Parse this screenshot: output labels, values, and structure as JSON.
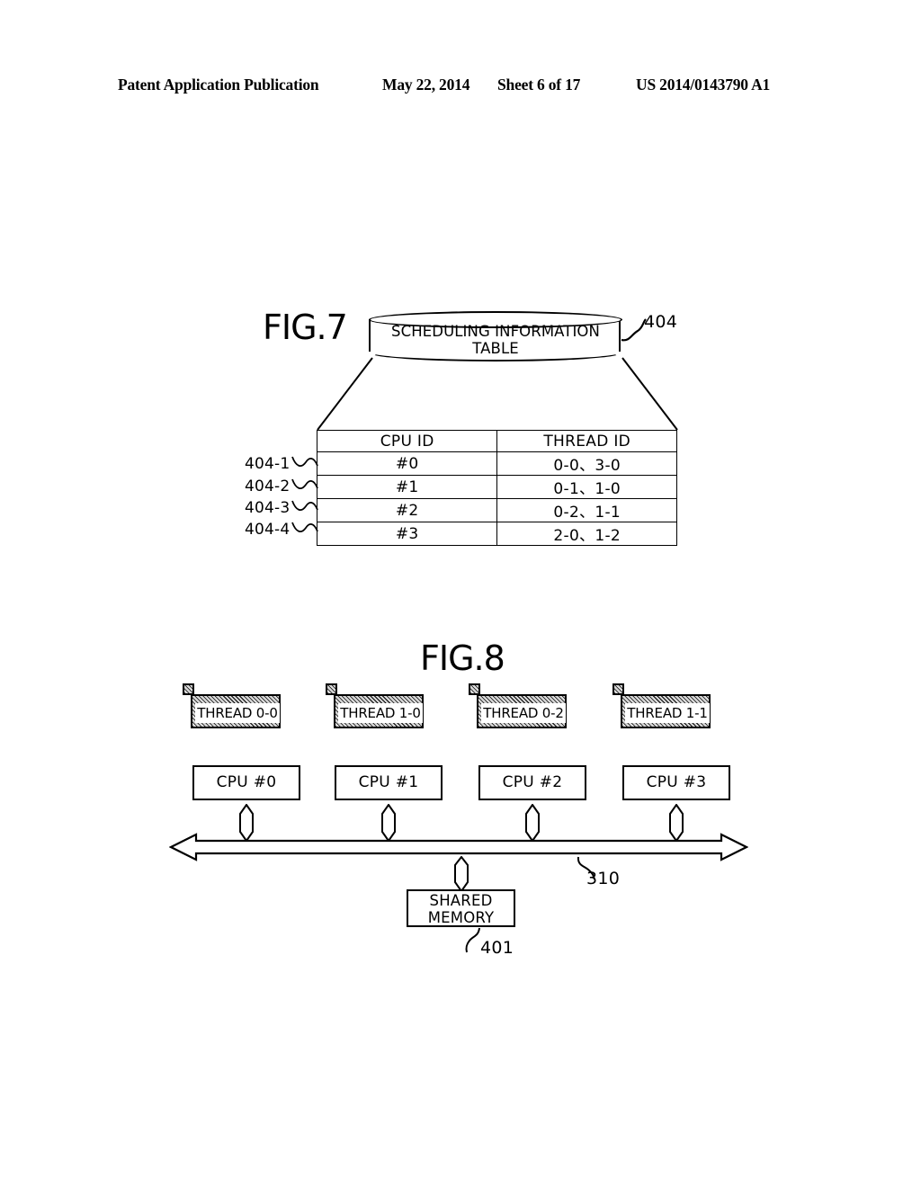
{
  "header": {
    "publication": "Patent Application Publication",
    "date": "May 22, 2014",
    "sheet": "Sheet 6 of 17",
    "patent_number": "US 2014/0143790 A1"
  },
  "fig7": {
    "label": "FIG.7",
    "cylinder_title": "SCHEDULING INFORMATION TABLE",
    "cylinder_ref": "404",
    "table": {
      "headers": [
        "CPU ID",
        "THREAD ID"
      ],
      "rows": [
        {
          "tag": "404-1",
          "cpu_id": "#0",
          "thread_id": "0-0、3-0"
        },
        {
          "tag": "404-2",
          "cpu_id": "#1",
          "thread_id": "0-1、1-0"
        },
        {
          "tag": "404-3",
          "cpu_id": "#2",
          "thread_id": "0-2、1-1"
        },
        {
          "tag": "404-4",
          "cpu_id": "#3",
          "thread_id": "2-0、1-2"
        }
      ]
    }
  },
  "fig8": {
    "label": "FIG.8",
    "threads": [
      {
        "label": "THREAD 0-0"
      },
      {
        "label": "THREAD 1-0"
      },
      {
        "label": "THREAD 0-2"
      },
      {
        "label": "THREAD 1-1"
      }
    ],
    "cpus": [
      {
        "label": "CPU #0"
      },
      {
        "label": "CPU #1"
      },
      {
        "label": "CPU #2"
      },
      {
        "label": "CPU #3"
      }
    ],
    "bus_ref": "310",
    "shared_memory": {
      "line1": "SHARED",
      "line2": "MEMORY",
      "ref": "401"
    }
  }
}
